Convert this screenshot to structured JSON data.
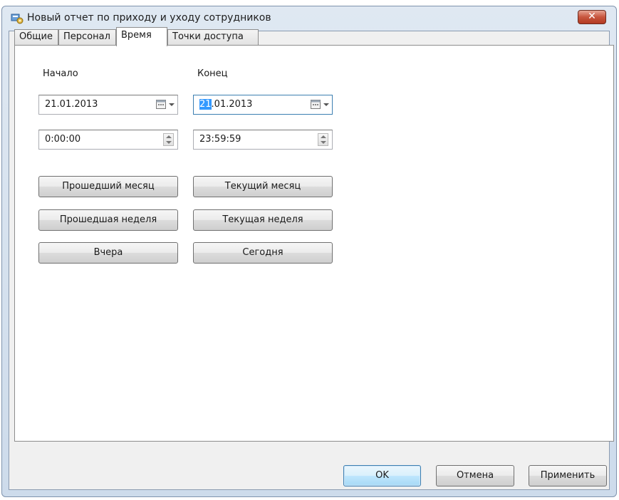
{
  "window": {
    "title": "Новый отчет по приходу и уходу сотрудников",
    "close_label": "✕"
  },
  "tabs": [
    {
      "label": "Общие",
      "active": false
    },
    {
      "label": "Персонал",
      "active": false
    },
    {
      "label": "Время",
      "active": true
    },
    {
      "label": "Точки доступа",
      "active": false
    }
  ],
  "time": {
    "start_label": "Начало",
    "end_label": "Конец",
    "start_date": "21.01.2013",
    "start_time": "0:00:00",
    "end_date_selected": "21",
    "end_date_rest": ".01.2013",
    "end_time": "23:59:59"
  },
  "presets": {
    "last_month": "Прошедший месяц",
    "current_month": "Текущий месяц",
    "last_week": "Прошедшая неделя",
    "current_week": "Текущая неделя",
    "yesterday": "Вчера",
    "today": "Сегодня"
  },
  "footer": {
    "ok": "OK",
    "cancel": "Отмена",
    "apply": "Применить"
  },
  "icons": {
    "app": "report-settings-icon",
    "calendar": "calendar-icon",
    "spinner": "spinner-arrows-icon"
  }
}
